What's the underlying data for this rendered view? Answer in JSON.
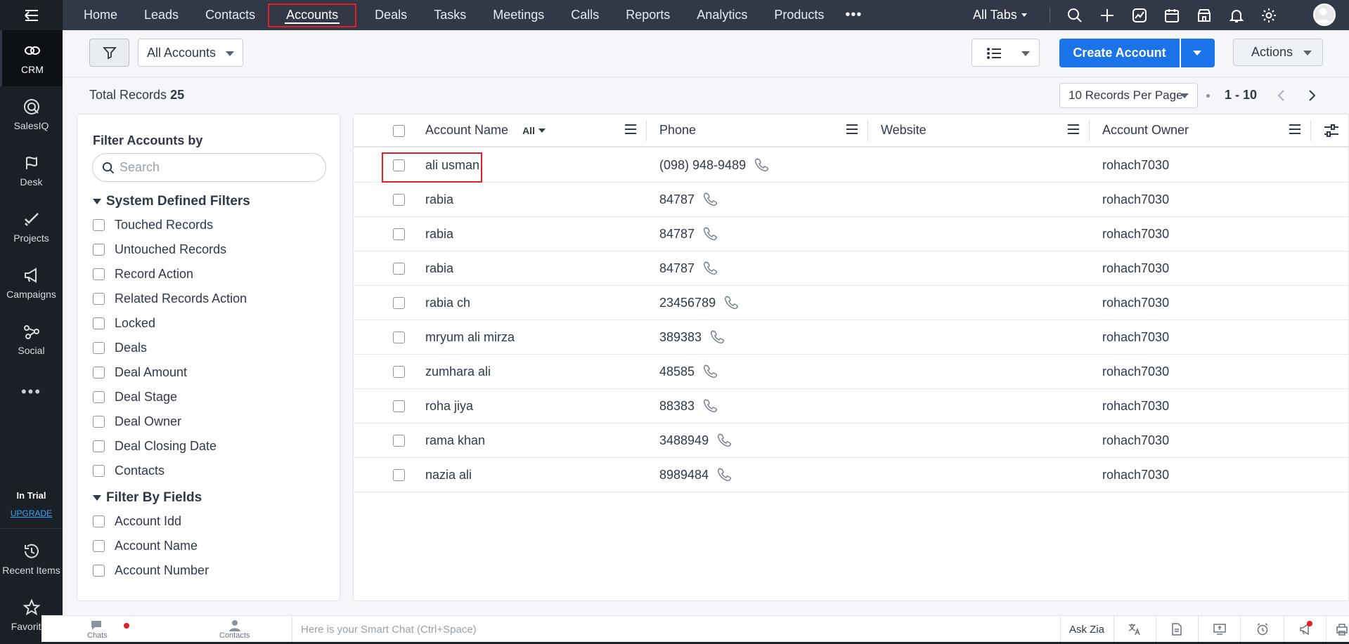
{
  "rail": {
    "apps": [
      {
        "label": "CRM"
      },
      {
        "label": "SalesIQ"
      },
      {
        "label": "Desk"
      },
      {
        "label": "Projects"
      },
      {
        "label": "Campaigns"
      },
      {
        "label": "Social"
      }
    ],
    "more": "•••",
    "trial": "In Trial",
    "upgrade": "UPGRADE",
    "recent": "Recent Items",
    "favorites": "Favorites"
  },
  "topnav": {
    "tabs": [
      "Home",
      "Leads",
      "Contacts",
      "Accounts",
      "Deals",
      "Tasks",
      "Meetings",
      "Calls",
      "Reports",
      "Analytics",
      "Products"
    ],
    "active_tab": "Accounts",
    "more": "•••",
    "all_tabs": "All Tabs"
  },
  "toolbar": {
    "view": "All Accounts",
    "create": "Create Account",
    "actions": "Actions"
  },
  "summary": {
    "total_label": "Total Records",
    "total_value": "25",
    "per_page": "10 Records Per Page",
    "range": "1 - 10"
  },
  "filters": {
    "title": "Filter Accounts by",
    "search_placeholder": "Search",
    "system_group": "System Defined Filters",
    "system_items": [
      "Touched Records",
      "Untouched Records",
      "Record Action",
      "Related Records Action",
      "Locked",
      "Deals",
      "Deal Amount",
      "Deal Stage",
      "Deal Owner",
      "Deal Closing Date",
      "Contacts"
    ],
    "fields_group": "Filter By Fields",
    "field_items": [
      "Account Idd",
      "Account Name",
      "Account Number"
    ]
  },
  "table": {
    "columns": {
      "account_name": "Account Name",
      "account_name_filter": "All",
      "phone": "Phone",
      "website": "Website",
      "owner": "Account Owner"
    },
    "rows": [
      {
        "name": "ali usman",
        "phone": "(098) 948-9489",
        "website": "",
        "owner": "rohach7030"
      },
      {
        "name": "rabia",
        "phone": "84787",
        "website": "",
        "owner": "rohach7030"
      },
      {
        "name": "rabia",
        "phone": "84787",
        "website": "",
        "owner": "rohach7030"
      },
      {
        "name": "rabia",
        "phone": "84787",
        "website": "",
        "owner": "rohach7030"
      },
      {
        "name": "rabia ch",
        "phone": "23456789",
        "website": "",
        "owner": "rohach7030"
      },
      {
        "name": "mryum ali mirza",
        "phone": "389383",
        "website": "",
        "owner": "rohach7030"
      },
      {
        "name": "zumhara ali",
        "phone": "48585",
        "website": "",
        "owner": "rohach7030"
      },
      {
        "name": "roha jiya",
        "phone": "88383",
        "website": "",
        "owner": "rohach7030"
      },
      {
        "name": "rama khan",
        "phone": "3488949",
        "website": "",
        "owner": "rohach7030"
      },
      {
        "name": "nazia ali",
        "phone": "8989484",
        "website": "",
        "owner": "rohach7030"
      }
    ]
  },
  "bottombar": {
    "chats": "Chats",
    "contacts": "Contacts",
    "smartchat_placeholder": "Here is your Smart Chat (Ctrl+Space)",
    "ask_zia": "Ask Zia"
  },
  "colors": {
    "nav_bg": "#313949",
    "rail_bg": "#1b1f26",
    "primary": "#1a73e8",
    "highlight": "#e01f26"
  }
}
